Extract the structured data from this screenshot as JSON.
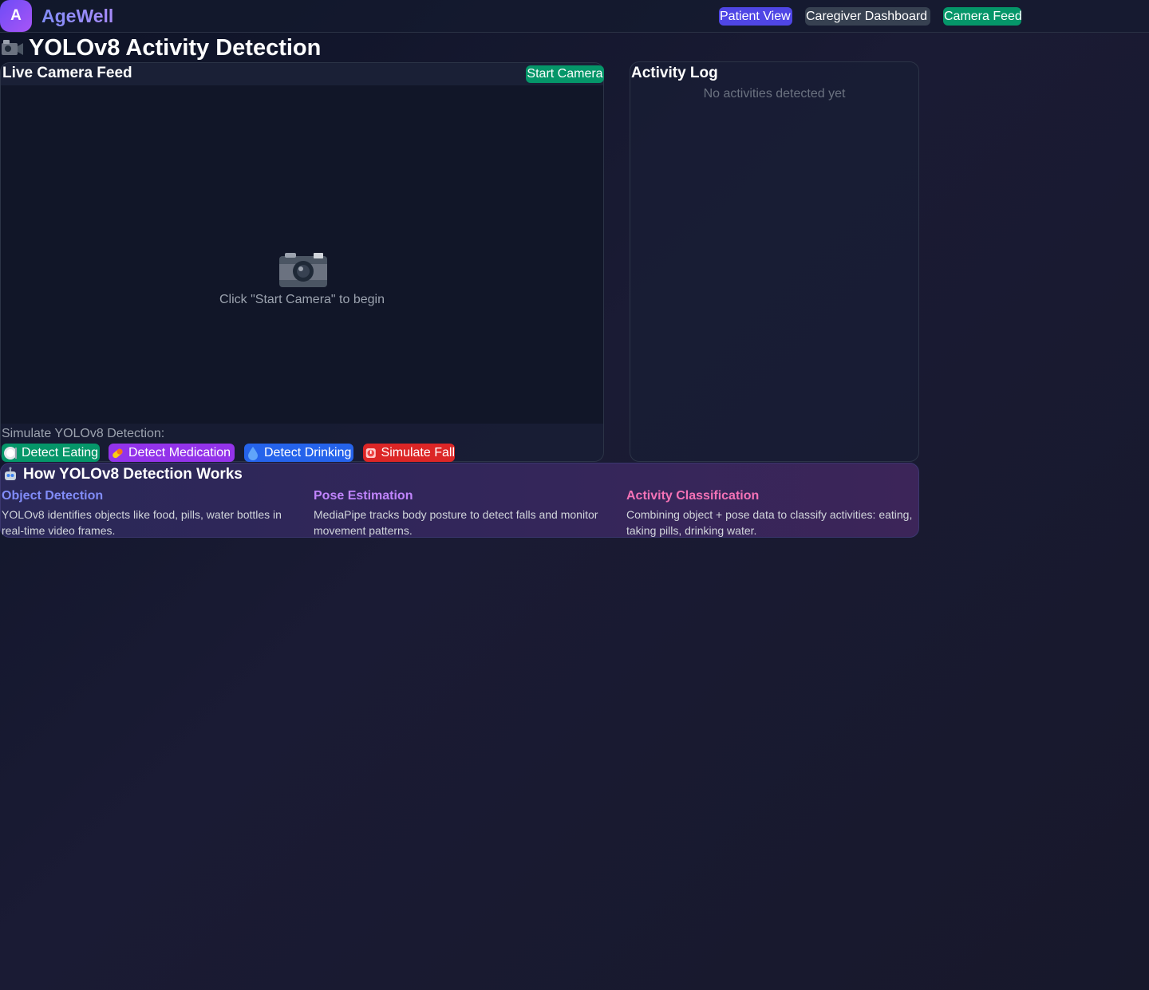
{
  "app": {
    "logo_letter": "A",
    "name": "AgeWell"
  },
  "nav": {
    "patient_view": "Patient View",
    "caregiver_dashboard": "Caregiver Dashboard",
    "camera_feed": "Camera Feed"
  },
  "page": {
    "title": "YOLOv8 Activity Detection"
  },
  "feed": {
    "title": "Live Camera Feed",
    "start_button": "Start Camera",
    "hint": "Click \"Start Camera\" to begin",
    "simulate_label": "Simulate YOLOv8 Detection:",
    "buttons": {
      "eating": "Detect Eating",
      "medication": "Detect Medication",
      "drinking": "Detect Drinking",
      "fall": "Simulate Fall"
    }
  },
  "log": {
    "title": "Activity Log",
    "empty": "No activities detected yet"
  },
  "how": {
    "title": "How YOLOv8 Detection Works",
    "columns": [
      {
        "heading": "Object Detection",
        "text": "YOLOv8 identifies objects like food, pills, water bottles in real-time video frames."
      },
      {
        "heading": "Pose Estimation",
        "text": "MediaPipe tracks body posture to detect falls and monitor movement patterns."
      },
      {
        "heading": "Activity Classification",
        "text": "Combining object + pose data to classify activities: eating, taking pills, drinking water."
      }
    ]
  },
  "colors": {
    "accent": "#4f46e5",
    "success": "#059669",
    "purple": "#9333ea",
    "blue": "#2563eb",
    "danger": "#dc2626"
  }
}
